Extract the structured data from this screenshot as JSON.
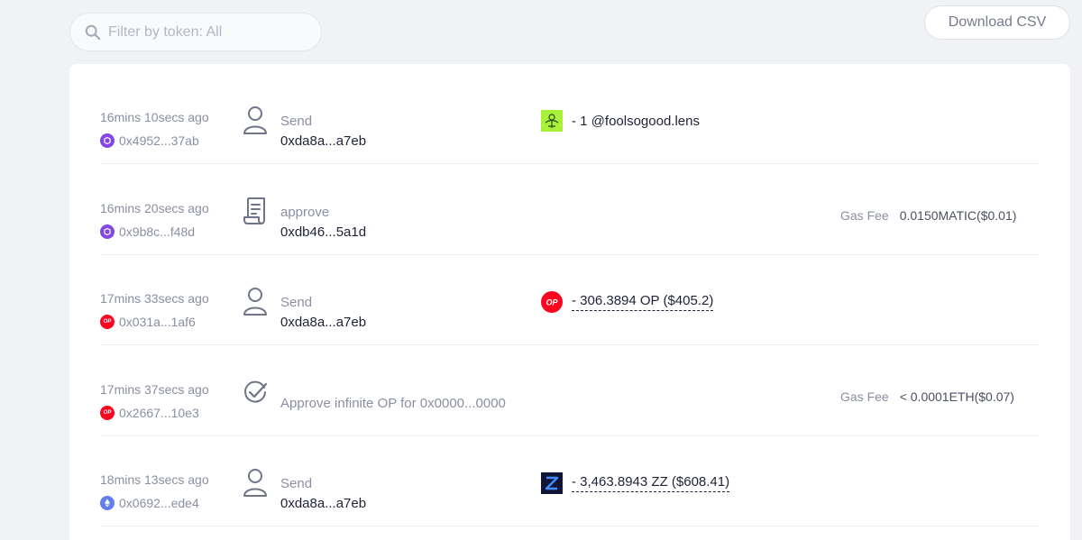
{
  "filter": {
    "placeholder": "Filter by token: All",
    "value": ""
  },
  "download_label": "Download CSV",
  "colors": {
    "polygon": "#8247e5",
    "optimism": "#ff0420",
    "ethereum": "#627eea"
  },
  "transactions": [
    {
      "time": "16mins 10secs ago",
      "chain": "polygon",
      "hash": "0x4952...37ab",
      "action_icon": "user-icon",
      "action": "Send",
      "address": "0xda8a...a7eb",
      "token_icon": "lens-profile-icon",
      "amount": "- 1 @foolsogood.lens"
    },
    {
      "time": "16mins 20secs ago",
      "chain": "polygon",
      "hash": "0x9b8c...f48d",
      "action_icon": "contract-scroll-icon",
      "action": "approve",
      "address": "0xdb46...5a1d",
      "gas_label": "Gas Fee",
      "gas_value": "0.0150MATIC($0.01)"
    },
    {
      "time": "17mins 33secs ago",
      "chain": "optimism",
      "hash": "0x031a...1af6",
      "action_icon": "user-icon",
      "action": "Send",
      "address": "0xda8a...a7eb",
      "token_icon": "op-token-icon",
      "amount": "- 306.3894 OP ($405.2)"
    },
    {
      "time": "17mins 37secs ago",
      "chain": "optimism",
      "hash": "0x2667...10e3",
      "action_icon": "check-circle-icon",
      "action": "Approve infinite OP for 0x0000...0000",
      "gas_label": "Gas Fee",
      "gas_value": "< 0.0001ETH($0.07)"
    },
    {
      "time": "18mins 13secs ago",
      "chain": "ethereum",
      "hash": "0x0692...ede4",
      "action_icon": "user-icon",
      "action": "Send",
      "address": "0xda8a...a7eb",
      "token_icon": "zz-token-icon",
      "amount": "- 3,463.8943 ZZ ($608.41)"
    }
  ]
}
